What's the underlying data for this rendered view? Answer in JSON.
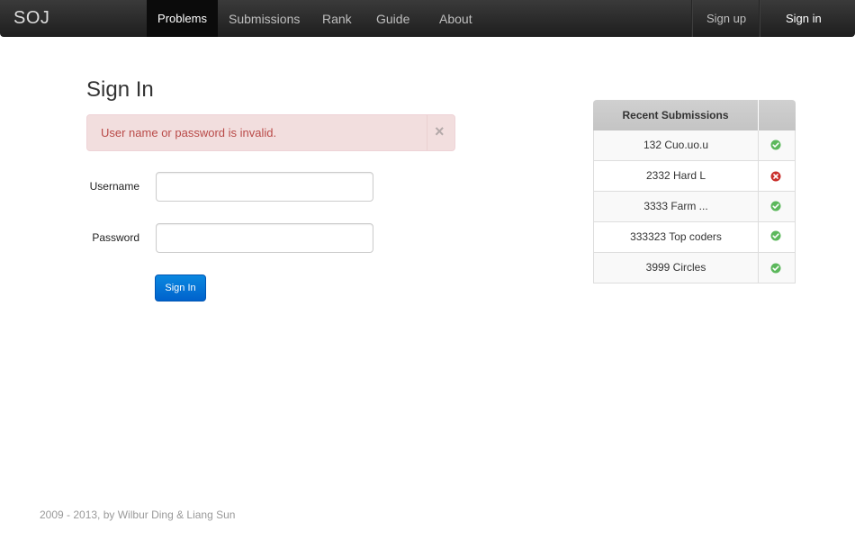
{
  "navbar": {
    "brand": "SOJ",
    "items": [
      {
        "label": "Problems"
      },
      {
        "label": "Submissions"
      },
      {
        "label": "Rank"
      },
      {
        "label": "Guide"
      },
      {
        "label": "About"
      }
    ],
    "signup_label": "Sign up",
    "signin_label": "Sign in"
  },
  "main": {
    "title": "Sign In",
    "alert": {
      "message": "User name or password is invalid.",
      "close_glyph": "×"
    },
    "form": {
      "username_label": "Username",
      "username_value": "",
      "password_label": "Password",
      "password_value": "",
      "submit_label": "Sign In"
    }
  },
  "submissions": {
    "header": "Recent Submissions",
    "rows": [
      {
        "label": "132 Cuo.uo.u",
        "status": "accepted"
      },
      {
        "label": "2332 Hard L",
        "status": "rejected"
      },
      {
        "label": "3333 Farm ...",
        "status": "accepted"
      },
      {
        "label": "333323 Top coders",
        "status": "accepted"
      },
      {
        "label": "3999 Circles",
        "status": "accepted"
      }
    ]
  },
  "footer": {
    "text": "2009 - 2013, by Wilbur Ding & Liang Sun"
  },
  "colors": {
    "navbar": "#2b2b2b",
    "active_nav": "#0b0b0b",
    "alert_bg": "#f2dede",
    "alert_text": "#b94a48",
    "primary": "#0a7ad9",
    "accepted": "#5cb85c",
    "rejected": "#c9302c"
  }
}
